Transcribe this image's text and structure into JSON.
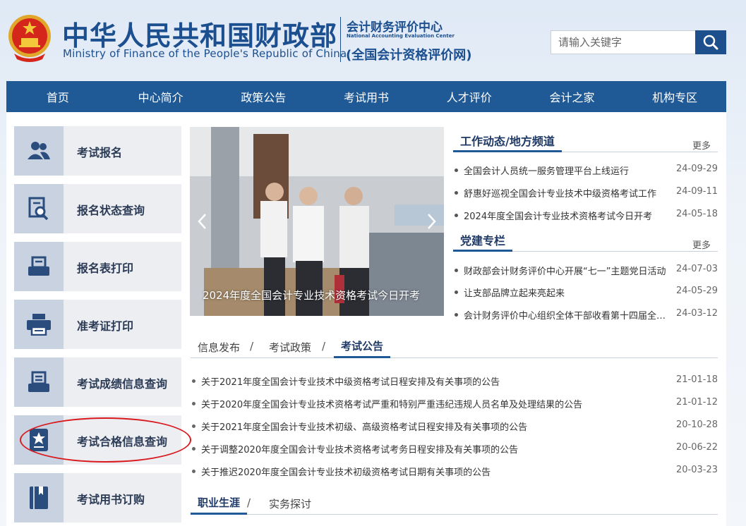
{
  "header": {
    "cn_title": "中华人民共和国财政部",
    "en_title": "Ministry of Finance of the People's Republic of China",
    "center_cn": "会计财务评价中心",
    "center_en": "National Accounting Evaluation Center",
    "center_sub": "(全国会计资格评价网)",
    "emblem_icon": "national-emblem"
  },
  "search": {
    "placeholder": "请输入关键字",
    "icon": "search-icon"
  },
  "nav": {
    "items": [
      "首页",
      "中心简介",
      "政策公告",
      "考试用书",
      "人才评价",
      "会计之家",
      "机构专区"
    ]
  },
  "sidebar": {
    "items": [
      {
        "label": "考试报名",
        "icon": "users-icon"
      },
      {
        "label": "报名状态查询",
        "icon": "document-search-icon"
      },
      {
        "label": "报名表打印",
        "icon": "print-form-icon"
      },
      {
        "label": "准考证打印",
        "icon": "printer-icon"
      },
      {
        "label": "考试成绩信息查询",
        "icon": "score-tray-icon"
      },
      {
        "label": "考试合格信息查询",
        "icon": "certificate-icon"
      },
      {
        "label": "考试用书订购",
        "icon": "book-icon"
      }
    ],
    "highlighted": "考试合格信息查询"
  },
  "banner": {
    "caption": "2024年度全国会计专业技术资格考试今日开考"
  },
  "work_news": {
    "title": "工作动态/地方频道",
    "more": "更多",
    "items": [
      {
        "title": "全国会计人员统一服务管理平台上线运行",
        "date": "24-09-29"
      },
      {
        "title": "舒惠好巡视全国会计专业技术中级资格考试工作",
        "date": "24-09-11"
      },
      {
        "title": "2024年度全国会计专业技术资格考试今日开考",
        "date": "24-05-18"
      }
    ]
  },
  "party": {
    "title": "党建专栏",
    "more": "更多",
    "items": [
      {
        "title": "财政部会计财务评价中心开展“七一”主题党日活动",
        "date": "24-07-03"
      },
      {
        "title": "让支部品牌立起来亮起来",
        "date": "24-05-29"
      },
      {
        "title": "会计财务评价中心组织全体干部收看第十四届全国人大",
        "date": "24-03-12"
      }
    ]
  },
  "notices": {
    "tabs": [
      "信息发布",
      "考试政策",
      "考试公告"
    ],
    "active_tab": "考试公告",
    "items": [
      {
        "title": "关于2021年度全国会计专业技术中级资格考试日程安排及有关事项的公告",
        "date": "21-01-18"
      },
      {
        "title": "关于2020年度全国会计专业技术资格考试严重和特别严重违纪违规人员名单及处理结果的公告",
        "date": "21-01-12"
      },
      {
        "title": "关于2021年度全国会计专业技术初级、高级资格考试日程安排及有关事项的公告",
        "date": "20-10-28"
      },
      {
        "title": "关于调整2020年度全国会计专业技术资格考试考务日程安排及有关事项的公告",
        "date": "20-06-22"
      },
      {
        "title": "关于推迟2020年度全国会计专业技术初级资格考试日期有关事项的公告",
        "date": "20-03-23"
      }
    ]
  },
  "career": {
    "tabs": [
      "职业生涯",
      "实务探讨"
    ],
    "active_tab": "职业生涯"
  },
  "colors": {
    "brand_blue": "#1f5a96",
    "highlight_red": "#d9191e"
  }
}
